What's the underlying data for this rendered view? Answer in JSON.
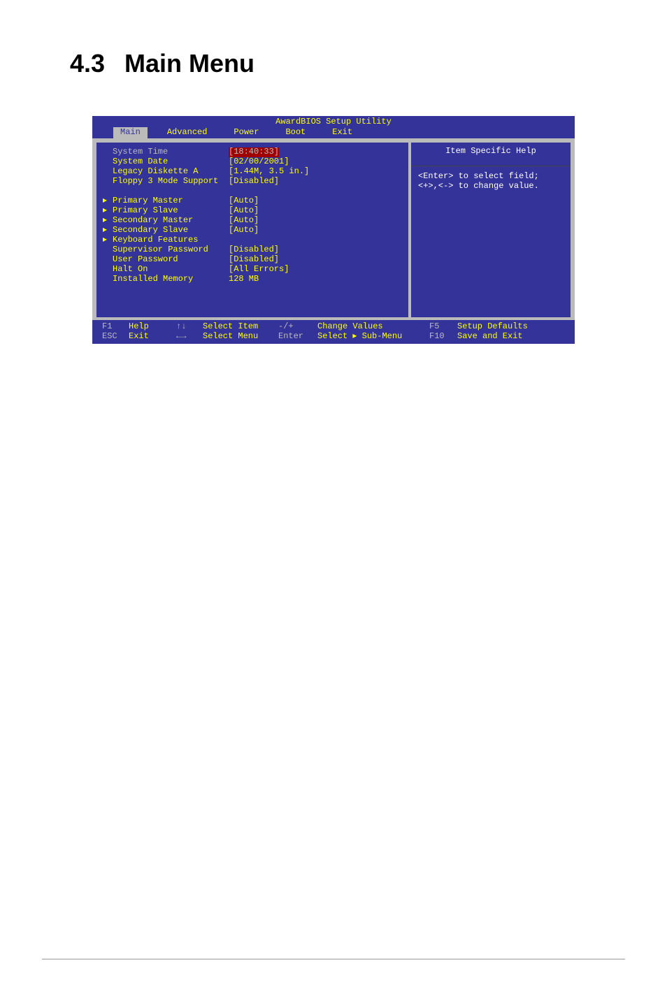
{
  "heading": {
    "number": "4.3",
    "title": "Main Menu"
  },
  "bios": {
    "title": "AwardBIOS Setup Utility",
    "tabs": [
      "Main",
      "Advanced",
      "Power",
      "Boot",
      "Exit"
    ],
    "active_tab": "Main",
    "fields": [
      {
        "arrow": "",
        "label": "System Time",
        "value": "[18:40:33]",
        "sel": true
      },
      {
        "arrow": "",
        "label": "System Date",
        "value": "[02/00/2001]"
      },
      {
        "arrow": "",
        "label": "Legacy Diskette A",
        "value": "[1.44M, 3.5 in.]"
      },
      {
        "arrow": "",
        "label": "Floppy 3 Mode Support",
        "value": "[Disabled]"
      },
      {
        "blank": true
      },
      {
        "arrow": "▸",
        "label": "Primary Master",
        "value": "[Auto]"
      },
      {
        "arrow": "▸",
        "label": "Primary Slave",
        "value": "[Auto]"
      },
      {
        "arrow": "▸",
        "label": "Secondary Master",
        "value": "[Auto]"
      },
      {
        "arrow": "▸",
        "label": "Secondary Slave",
        "value": "[Auto]"
      },
      {
        "arrow": "▸",
        "label": "Keyboard Features",
        "value": ""
      },
      {
        "arrow": "",
        "label": "Supervisor Password",
        "value": "[Disabled]"
      },
      {
        "arrow": "",
        "label": "User Password",
        "value": "[Disabled]"
      },
      {
        "arrow": "",
        "label": "Halt On",
        "value": "[All Errors]"
      },
      {
        "arrow": "",
        "label": "Installed Memory",
        "value": "128 MB"
      }
    ],
    "help": {
      "heading": "Item Specific Help",
      "line1": "<Enter> to select field;",
      "line2": "<+>,<-> to change value."
    },
    "footer": {
      "f1": "F1",
      "help": "Help",
      "updown": "↑↓",
      "selectitem": "Select Item",
      "pm": "-/+",
      "changevalues": "Change Values",
      "f5": "F5",
      "setupdefaults": "Setup Defaults",
      "esc": "ESC",
      "exit": "Exit",
      "leftright": "←→",
      "selectmenu": "Select Menu",
      "enter": "Enter",
      "selectsubmenu": "Select ▸ Sub-Menu",
      "f10": "F10",
      "saveexit": "Save and Exit"
    }
  }
}
